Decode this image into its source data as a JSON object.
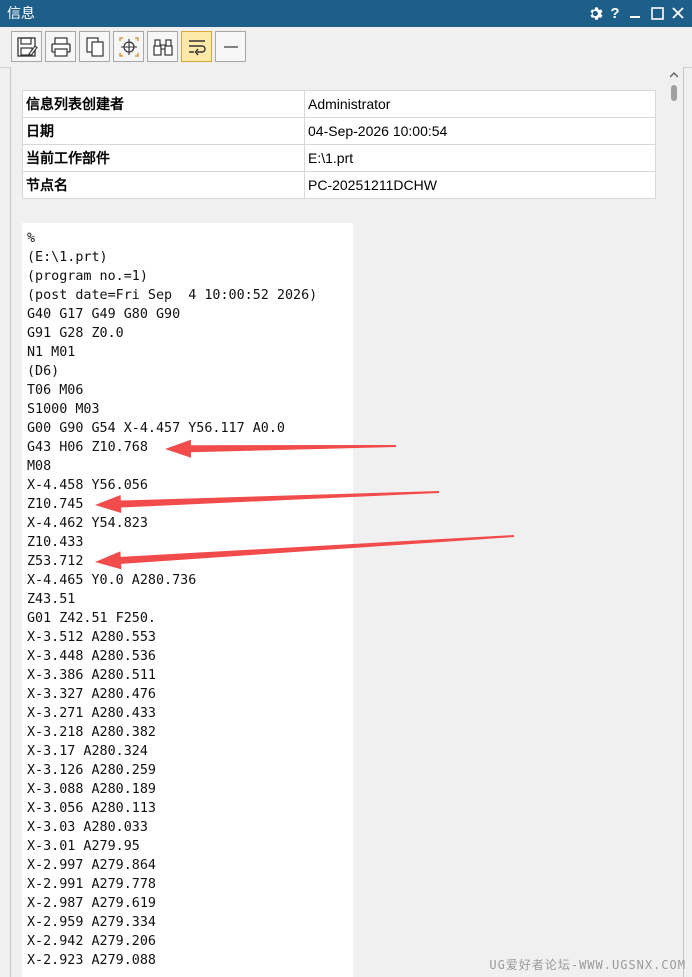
{
  "window": {
    "title": "信息"
  },
  "info_table": [
    {
      "label": "信息列表创建者",
      "value": "Administrator"
    },
    {
      "label": "日期",
      "value": "04-Sep-2026 10:00:54"
    },
    {
      "label": "当前工作部件",
      "value": "E:\\1.prt"
    },
    {
      "label": "节点名",
      "value": "PC-20251211DCHW"
    }
  ],
  "code_lines": [
    "%",
    "(E:\\1.prt)",
    "(program no.=1)",
    "(post date=Fri Sep  4 10:00:52 2026)",
    "G40 G17 G49 G80 G90",
    "G91 G28 Z0.0",
    "N1 M01",
    "(D6)",
    "T06 M06",
    "S1000 M03",
    "G00 G90 G54 X-4.457 Y56.117 A0.0",
    "G43 H06 Z10.768",
    "M08",
    "X-4.458 Y56.056",
    "Z10.745",
    "X-4.462 Y54.823",
    "Z10.433",
    "Z53.712",
    "X-4.465 Y0.0 A280.736",
    "Z43.51",
    "G01 Z42.51 F250.",
    "X-3.512 A280.553",
    "X-3.448 A280.536",
    "X-3.386 A280.511",
    "X-3.327 A280.476",
    "X-3.271 A280.433",
    "X-3.218 A280.382",
    "X-3.17 A280.324",
    "X-3.126 A280.259",
    "X-3.088 A280.189",
    "X-3.056 A280.113",
    "X-3.03 A280.033",
    "X-3.01 A279.95",
    "X-2.997 A279.864",
    "X-2.991 A279.778",
    "X-2.987 A279.619",
    "X-2.959 A279.334",
    "X-2.942 A279.206",
    "X-2.923 A279.088"
  ],
  "annotation_color": "#f24b4b",
  "watermark": "UG爱好者论坛-WWW.UGSNX.COM"
}
